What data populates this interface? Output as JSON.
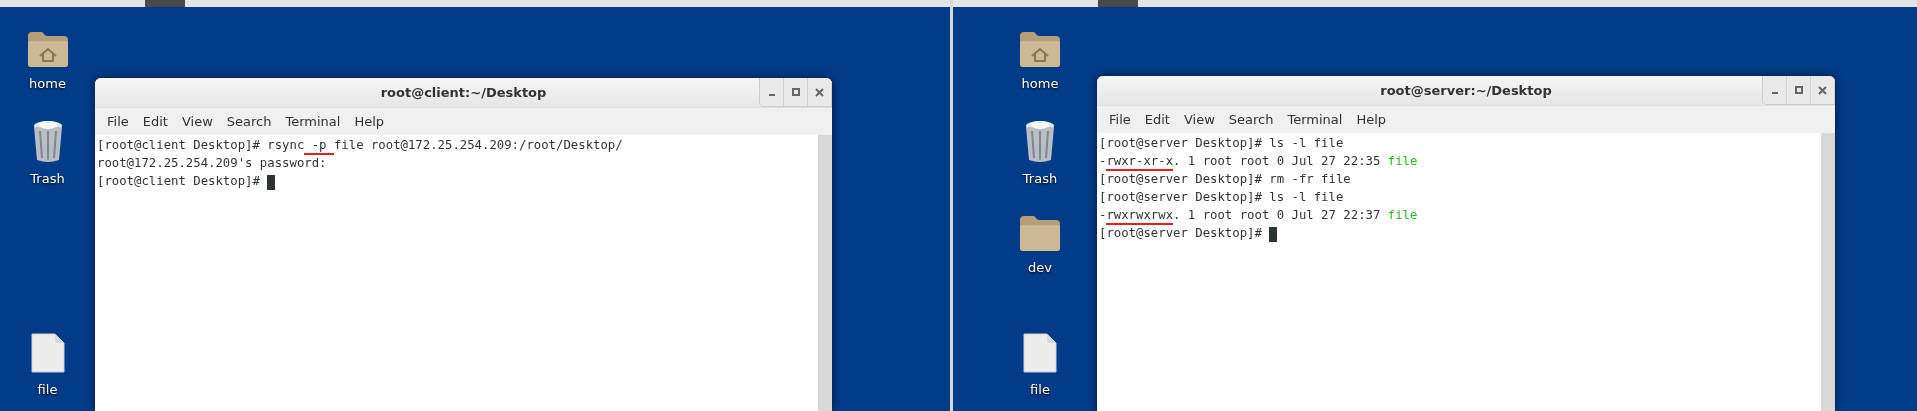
{
  "screens": [
    {
      "desktop_icons": [
        {
          "label": "home",
          "kind": "folder-home"
        },
        {
          "label": "Trash",
          "kind": "trash"
        },
        {
          "label": "file",
          "kind": "file"
        }
      ],
      "terminal": {
        "title": "root@client:~/Desktop",
        "menu": [
          "File",
          "Edit",
          "View",
          "Search",
          "Terminal",
          "Help"
        ],
        "cursor": true,
        "lines": [
          [
            {
              "text": "[root@client Desktop]# rsync",
              "kind": "plain",
              "underlined": false
            },
            {
              "text": " -p ",
              "kind": "plain",
              "underlined": true
            },
            {
              "text": "file root@172.25.254.209:/root/Desktop/",
              "kind": "plain",
              "underlined": false
            }
          ],
          [
            {
              "text": "root@172.25.254.209's password:",
              "kind": "plain",
              "underlined": false
            }
          ],
          [
            {
              "text": "[root@client Desktop]# ",
              "kind": "plain",
              "underlined": false
            }
          ]
        ]
      }
    },
    {
      "desktop_icons": [
        {
          "label": "home",
          "kind": "folder-home"
        },
        {
          "label": "Trash",
          "kind": "trash"
        },
        {
          "label": "dev",
          "kind": "folder"
        },
        {
          "label": "file",
          "kind": "file"
        }
      ],
      "terminal": {
        "title": "root@server:~/Desktop",
        "menu": [
          "File",
          "Edit",
          "View",
          "Search",
          "Terminal",
          "Help"
        ],
        "cursor": true,
        "lines": [
          [
            {
              "text": "[root@server Desktop]# ls -l file",
              "kind": "plain",
              "underlined": false
            }
          ],
          [
            {
              "text": "-",
              "kind": "plain",
              "underlined": false
            },
            {
              "text": "rwxr-xr-x",
              "kind": "plain",
              "underlined": true
            },
            {
              "text": ". 1 root root 0 Jul 27 22:35 ",
              "kind": "plain",
              "underlined": false
            },
            {
              "text": "file",
              "kind": "file-name",
              "underlined": false
            }
          ],
          [
            {
              "text": "[root@server Desktop]# rm -fr file",
              "kind": "plain",
              "underlined": false
            }
          ],
          [
            {
              "text": "[root@server Desktop]# ls -l file",
              "kind": "plain",
              "underlined": false
            }
          ],
          [
            {
              "text": "-",
              "kind": "plain",
              "underlined": false
            },
            {
              "text": "rwxrwxrwx",
              "kind": "plain",
              "underlined": true
            },
            {
              "text": ". 1 root root 0 Jul 27 22:37 ",
              "kind": "plain",
              "underlined": false
            },
            {
              "text": "file",
              "kind": "file-name",
              "underlined": false
            }
          ],
          [
            {
              "text": "[root@server Desktop]# ",
              "kind": "plain",
              "underlined": false
            }
          ]
        ]
      }
    }
  ]
}
